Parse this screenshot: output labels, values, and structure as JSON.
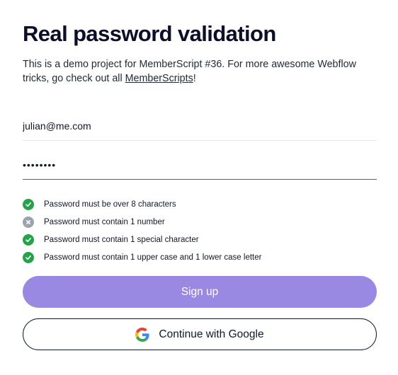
{
  "heading": "Real password validation",
  "description": {
    "text": "This is a demo project for MemberScript #36. For more awesome Webflow tricks, go check out all ",
    "link_text": "MemberScripts",
    "trailing": "!"
  },
  "form": {
    "email_value": "julian@me.com",
    "password_value": "••••••••"
  },
  "requirements": [
    {
      "label": "Password must be over 8 characters",
      "met": true
    },
    {
      "label": "Password must contain 1 number",
      "met": false
    },
    {
      "label": "Password must contain 1 special character",
      "met": true
    },
    {
      "label": "Password must contain 1 upper case and 1 lower case letter",
      "met": true
    }
  ],
  "buttons": {
    "signup_label": "Sign up",
    "google_label": "Continue with Google"
  },
  "colors": {
    "met": "#22a447",
    "unmet": "#9ca3af",
    "signup_bg": "#9a89e2"
  },
  "icons": {
    "met": "check-circle-icon",
    "unmet": "x-circle-icon",
    "google": "google-icon"
  }
}
